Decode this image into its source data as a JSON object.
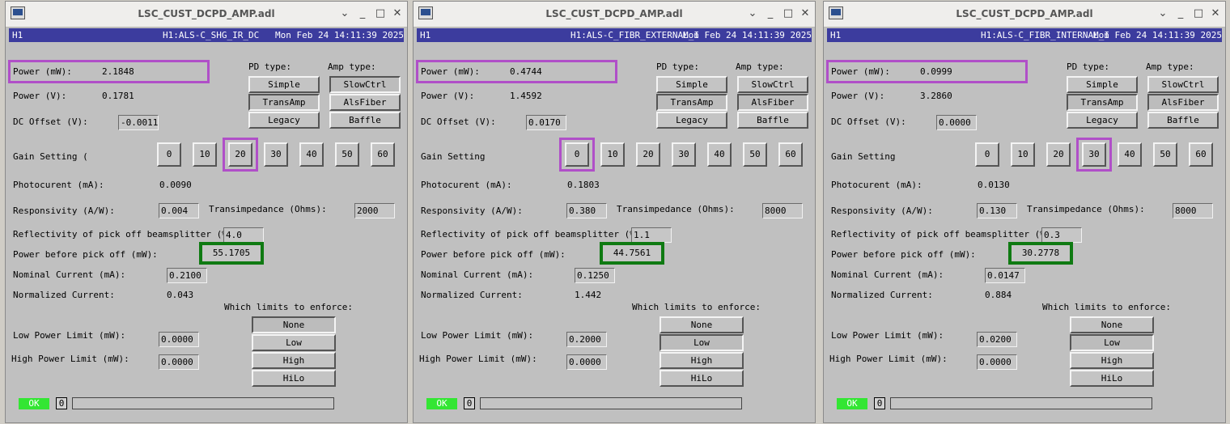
{
  "windows": [
    {
      "title": "LSC_CUST_DCPD_AMP.adl",
      "header": {
        "site": "H1",
        "channel": "H1:ALS-C_SHG_IR_DC",
        "date": "Mon Feb 24 14:11:39 2025"
      },
      "labels": {
        "power_mw": "Power (mW):",
        "power_v": "Power (V):",
        "dc_offset": "DC Offset (V):",
        "pd_type": "PD type:",
        "amp_type": "Amp type:",
        "gain": "Gain Setting (",
        "photocurrent": "Photocurent (mA):",
        "responsivity": "Responsivity (A/W):",
        "transimpedance": "Transimpedance (Ohms):",
        "reflectivity": "Reflectivity of pick off beamsplitter (%):",
        "power_before": "Power before pick off (mW):",
        "nominal_current": "Nominal Current (mA):",
        "normalized_current": "Normalized Current:",
        "which_limits": "Which limits to enforce:",
        "low_limit": "Low Power Limit (mW):",
        "high_limit": "High Power Limit (mW):"
      },
      "values": {
        "power_mw": "2.1848",
        "power_v": "0.1781",
        "dc_offset": "-0.0011",
        "photocurrent": "0.0090",
        "responsivity": "0.004",
        "transimpedance": "2000",
        "reflectivity": "4.0",
        "power_before": "55.1705",
        "nominal_current": "0.2100",
        "normalized_current": "0.043",
        "low_limit": "0.0000",
        "high_limit": "0.0000"
      },
      "pd_buttons": [
        "Simple",
        "TransAmp",
        "Legacy"
      ],
      "amp_buttons": [
        "SlowCtrl",
        "AlsFiber",
        "Baffle"
      ],
      "gain_buttons": [
        "0",
        "10",
        "20",
        "30",
        "40",
        "50",
        "60"
      ],
      "limit_buttons": [
        "None",
        "Low",
        "High",
        "HiLo"
      ],
      "ok_label": "OK",
      "ok_value": "0"
    },
    {
      "title": "LSC_CUST_DCPD_AMP.adl",
      "header": {
        "site": "H1",
        "channel": "H1:ALS-C_FIBR_EXTERNAL_I",
        "date": "Mon Feb 24 14:11:39 2025"
      },
      "labels": {
        "power_mw": "Power (mW):",
        "power_v": "Power (V):",
        "dc_offset": "DC Offset (V):",
        "pd_type": "PD type:",
        "amp_type": "Amp type:",
        "gain": "Gain Setting",
        "photocurrent": "Photocurent (mA):",
        "responsivity": "Responsivity (A/W):",
        "transimpedance": "Transimpedance (Ohms):",
        "reflectivity": "Reflectivity of pick off beamsplitter (%):",
        "power_before": "Power before pick off (mW):",
        "nominal_current": "Nominal Current (mA):",
        "normalized_current": "Normalized Current:",
        "which_limits": "Which limits to enforce:",
        "low_limit": "Low Power Limit (mW):",
        "high_limit": "High Power Limit (mW):"
      },
      "values": {
        "power_mw": "0.4744",
        "power_v": "1.4592",
        "dc_offset": "0.0170",
        "photocurrent": "0.1803",
        "responsivity": "0.380",
        "transimpedance": "8000",
        "reflectivity": "1.1",
        "power_before": "44.7561",
        "nominal_current": "0.1250",
        "normalized_current": "1.442",
        "low_limit": "0.2000",
        "high_limit": "0.0000"
      },
      "pd_buttons": [
        "Simple",
        "TransAmp",
        "Legacy"
      ],
      "amp_buttons": [
        "SlowCtrl",
        "AlsFiber",
        "Baffle"
      ],
      "gain_buttons": [
        "0",
        "10",
        "20",
        "30",
        "40",
        "50",
        "60"
      ],
      "limit_buttons": [
        "None",
        "Low",
        "High",
        "HiLo"
      ],
      "ok_label": "OK",
      "ok_value": "0"
    },
    {
      "title": "LSC_CUST_DCPD_AMP.adl",
      "header": {
        "site": "H1",
        "channel": "H1:ALS-C_FIBR_INTERNAL_I",
        "date": "Mon Feb 24 14:11:39 2025"
      },
      "labels": {
        "power_mw": "Power (mW):",
        "power_v": "Power (V):",
        "dc_offset": "DC Offset (V):",
        "pd_type": "PD type:",
        "amp_type": "Amp type:",
        "gain": "Gain Setting",
        "photocurrent": "Photocurent (mA):",
        "responsivity": "Responsivity (A/W):",
        "transimpedance": "Transimpedance (Ohms):",
        "reflectivity": "Reflectivity of pick off beamsplitter (%):",
        "power_before": "Power before pick off (mW):",
        "nominal_current": "Nominal Current (mA):",
        "normalized_current": "Normalized Current:",
        "which_limits": "Which limits to enforce:",
        "low_limit": "Low Power Limit (mW):",
        "high_limit": "High Power Limit (mW):"
      },
      "values": {
        "power_mw": "0.0999",
        "power_v": "3.2860",
        "dc_offset": "0.0000",
        "photocurrent": "0.0130",
        "responsivity": "0.130",
        "transimpedance": "8000",
        "reflectivity": "0.3",
        "power_before": "30.2778",
        "nominal_current": "0.0147",
        "normalized_current": "0.884",
        "low_limit": "0.0200",
        "high_limit": "0.0000"
      },
      "pd_buttons": [
        "Simple",
        "TransAmp",
        "Legacy"
      ],
      "amp_buttons": [
        "SlowCtrl",
        "AlsFiber",
        "Baffle"
      ],
      "gain_buttons": [
        "0",
        "10",
        "20",
        "30",
        "40",
        "50",
        "60"
      ],
      "limit_buttons": [
        "None",
        "Low",
        "High",
        "HiLo"
      ],
      "ok_label": "OK",
      "ok_value": "0"
    }
  ],
  "window_controls": {
    "menu": "⌄",
    "minimize": "_",
    "maximize": "□",
    "close": "✕"
  },
  "colors": {
    "panel": "#c0c0c0",
    "header": "#3c3c9e",
    "highlight_purple": "#b04fc8",
    "highlight_green": "#0f7a12",
    "ok_green": "#33e633"
  }
}
